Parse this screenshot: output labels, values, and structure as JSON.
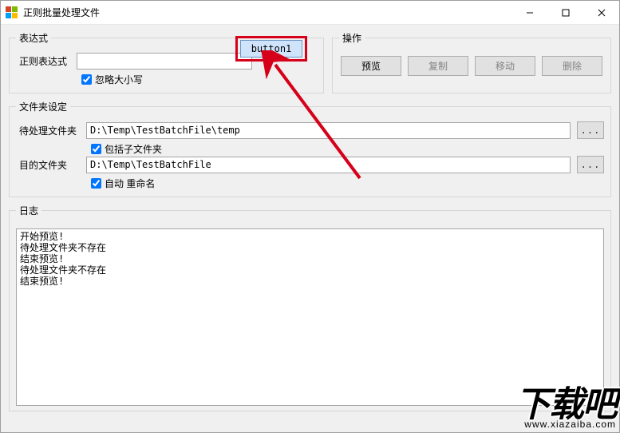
{
  "window": {
    "title": "正则批量处理文件"
  },
  "highlight_button": "button1",
  "expression_group": {
    "legend": "表达式",
    "regex_label": "正则表达式",
    "regex_value": "",
    "ignore_case_label": "忽略大小写",
    "ignore_case_checked": true
  },
  "ops_group": {
    "legend": "操作",
    "preview": "预览",
    "copy": "复制",
    "move": "移动",
    "delete": "删除"
  },
  "folder_group": {
    "legend": "文件夹设定",
    "source_label": "待处理文件夹",
    "source_value": "D:\\Temp\\TestBatchFile\\temp",
    "include_sub_label": "包括子文件夹",
    "include_sub_checked": true,
    "target_label": "目的文件夹",
    "target_value": "D:\\Temp\\TestBatchFile",
    "auto_rename_label": "自动 重命名",
    "auto_rename_checked": true,
    "browse_label": "..."
  },
  "log_group": {
    "legend": "日志",
    "content": "开始预览!\n待处理文件夹不存在\n结束预览!\n待处理文件夹不存在\n结束预览!"
  },
  "watermark": {
    "big": "下载吧",
    "url": "www.xiazaiba.com"
  }
}
